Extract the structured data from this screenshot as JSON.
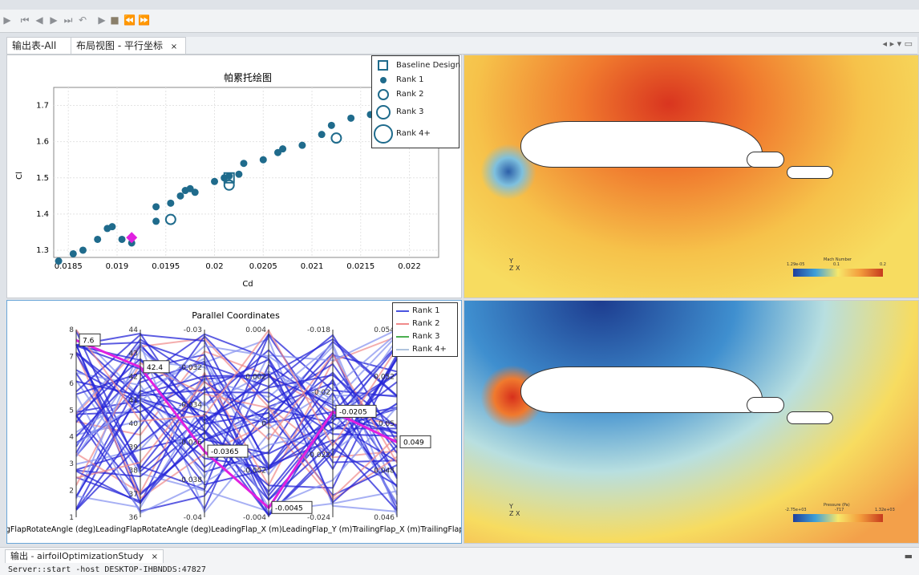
{
  "toolbar": {
    "icons": [
      "play-icon",
      "skip-start-icon",
      "step-back-icon",
      "step-forward-icon",
      "skip-end-icon",
      "undo-icon",
      "run-icon",
      "stop-icon",
      "prev-icon",
      "next-icon"
    ]
  },
  "tabs": [
    {
      "label": "输出表-All",
      "close": "×"
    },
    {
      "label": "布局视图 - 平行坐标",
      "close": "×"
    }
  ],
  "pareto": {
    "title": "帕累托绘图",
    "xlabel": "Cd",
    "ylabel": "Cl",
    "xticks": [
      "0.0185",
      "0.019",
      "0.0195",
      "0.02",
      "0.0205",
      "0.021",
      "0.0215",
      "0.022"
    ],
    "yticks": [
      "1.3",
      "1.4",
      "1.5",
      "1.6",
      "1.7"
    ],
    "legend": [
      "Baseline Design",
      "Rank 1",
      "Rank 2",
      "Rank 3",
      "Rank 4+"
    ]
  },
  "parallel": {
    "title": "Parallel Coordinates",
    "axis_labels_row": "LeadingFlapRotateAngle (deg)LeadingFlapRotateAngle (deg)LeadingFlap_X (m)LeadingFlap_Y (m)TrailingFlap_X (m)TrailingFlap_Y (m)",
    "legend": [
      "Rank 1",
      "Rank 2",
      "Rank 3",
      "Rank 4+"
    ],
    "axis1_ticks": [
      "8",
      "7",
      "6",
      "5",
      "4",
      "3",
      "2",
      "1"
    ],
    "axis2_ticks": [
      "44",
      "43",
      "42",
      "41",
      "40",
      "39",
      "38",
      "37",
      "36"
    ],
    "axis3_ticks": [
      "-0.03",
      "-0.032",
      "-0.034",
      "-0.036",
      "-0.038",
      "-0.04"
    ],
    "axis4_ticks": [
      "0.004",
      "0.002",
      "0",
      "-0.002",
      "-0.004"
    ],
    "axis5_ticks": [
      "-0.018",
      "-0.02",
      "-0.022",
      "-0.024"
    ],
    "axis6_ticks": [
      "0.054",
      "0.052",
      "0.05",
      "0.048",
      "0.046"
    ],
    "annotations": [
      "7.6",
      "42.4",
      "-0.0365",
      "-0.0045",
      "-0.0205",
      "0.049"
    ]
  },
  "cfd_top": {
    "axes": "Y\nZ X",
    "colorbar_title": "Mach Number",
    "colorbar_ticks": [
      "1.29e-05",
      "0.1",
      "0.2"
    ]
  },
  "cfd_bottom": {
    "axes": "Y\nZ X",
    "colorbar_title": "Pressure (Pa)",
    "colorbar_ticks": [
      "-2.75e+03",
      "-717",
      "1.32e+03"
    ]
  },
  "output": {
    "tab_label": "输出 - airfoilOptimizationStudy",
    "close": "×",
    "line": "Server::start -host DESKTOP-IHBNDDS:47827"
  },
  "colors": {
    "series_blue": "#1f6b8c",
    "magenta": "#e020e0",
    "rank1": "#4a55e0",
    "rank2": "#f08a8a"
  },
  "chart_data": [
    {
      "type": "scatter",
      "title": "帕累托绘图",
      "xlabel": "Cd",
      "ylabel": "Cl",
      "xlim": [
        0.01835,
        0.0223
      ],
      "ylim": [
        1.28,
        1.75
      ],
      "series": [
        {
          "name": "Rank 1",
          "points": [
            [
              0.0184,
              1.27
            ],
            [
              0.01855,
              1.29
            ],
            [
              0.01865,
              1.3
            ],
            [
              0.0188,
              1.33
            ],
            [
              0.0189,
              1.36
            ],
            [
              0.01895,
              1.365
            ],
            [
              0.01905,
              1.33
            ],
            [
              0.01915,
              1.32
            ],
            [
              0.0194,
              1.38
            ],
            [
              0.0194,
              1.42
            ],
            [
              0.01955,
              1.43
            ],
            [
              0.01965,
              1.45
            ],
            [
              0.0197,
              1.465
            ],
            [
              0.01975,
              1.47
            ],
            [
              0.0198,
              1.46
            ],
            [
              0.02,
              1.49
            ],
            [
              0.0201,
              1.5
            ],
            [
              0.02015,
              1.505
            ],
            [
              0.02025,
              1.51
            ],
            [
              0.0203,
              1.54
            ],
            [
              0.0205,
              1.55
            ],
            [
              0.02065,
              1.57
            ],
            [
              0.0207,
              1.58
            ],
            [
              0.0209,
              1.59
            ],
            [
              0.0211,
              1.62
            ],
            [
              0.0212,
              1.645
            ],
            [
              0.0214,
              1.665
            ],
            [
              0.0216,
              1.675
            ],
            [
              0.02185,
              1.7
            ],
            [
              0.0218,
              1.73
            ]
          ]
        },
        {
          "name": "Rank 2",
          "points": [
            [
              0.01955,
              1.385
            ],
            [
              0.02015,
              1.48
            ],
            [
              0.02125,
              1.61
            ],
            [
              0.0219,
              1.735
            ]
          ]
        },
        {
          "name": "Baseline Design",
          "points": [
            [
              0.02015,
              1.5
            ]
          ]
        },
        {
          "name": "Rank 3",
          "points": [
            [
              0.02195,
              1.72
            ]
          ]
        }
      ],
      "highlight": {
        "x": 0.01915,
        "y": 1.335
      }
    },
    {
      "type": "line",
      "title": "Parallel Coordinates",
      "note_axes": "6 axes",
      "axes_ranges": [
        [
          1,
          8
        ],
        [
          36,
          44
        ],
        [
          -0.04,
          -0.03
        ],
        [
          -0.005,
          0.005
        ],
        [
          -0.025,
          -0.017
        ],
        [
          0.045,
          0.055
        ]
      ],
      "highlighted_line": [
        7.6,
        42.4,
        -0.0365,
        -0.0045,
        -0.0205,
        0.049
      ]
    }
  ]
}
